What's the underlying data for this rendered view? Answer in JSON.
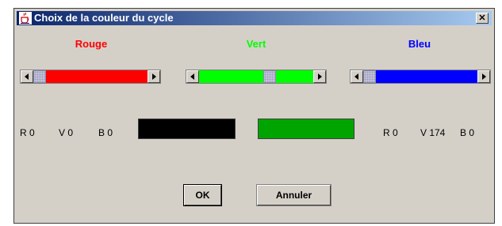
{
  "window": {
    "title": "Choix de la couleur du cycle",
    "close_label": "✕"
  },
  "channels": [
    {
      "label": "Rouge",
      "color": "#ff0000",
      "value": 0
    },
    {
      "label": "Vert",
      "color": "#00ff00",
      "value": 174
    },
    {
      "label": "Bleu",
      "color": "#0000ff",
      "value": 0
    }
  ],
  "previous": {
    "r": "R 0",
    "g": "V 0",
    "b": "B 0",
    "swatch_color": "#000000"
  },
  "current": {
    "r": "R 0",
    "g": "V 174",
    "b": "B 0",
    "swatch_color": "#00a400"
  },
  "buttons": {
    "ok": "OK",
    "cancel": "Annuler"
  },
  "colors": {
    "title_start": "#0a246a",
    "title_end": "#a6caf0",
    "dialog_bg": "#d4d0c8"
  },
  "icons": {
    "app": "java-cup-icon",
    "close": "close-icon"
  }
}
